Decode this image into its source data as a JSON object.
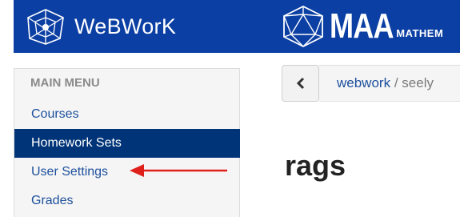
{
  "app": {
    "name": "WeBWorK",
    "sponsor_name": "MAA",
    "sponsor_subtext": "MATHEM"
  },
  "sidebar": {
    "header": "MAIN MENU",
    "items": [
      {
        "label": "Courses"
      },
      {
        "label": "Homework Sets",
        "active": true
      },
      {
        "label": "User Settings"
      },
      {
        "label": "Grades"
      }
    ]
  },
  "breadcrumb": {
    "back_icon": "chevron-left-icon",
    "root": "webwork",
    "separator": "/",
    "current": "seely"
  },
  "page": {
    "title": "rags"
  },
  "colors": {
    "header_bg": "#0b3fa3",
    "active_item_bg": "#003478",
    "link": "#1c4f9c",
    "annotation_arrow": "#e0201b"
  }
}
